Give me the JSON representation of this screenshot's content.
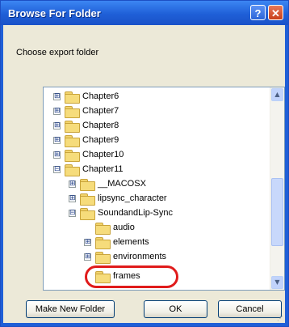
{
  "window": {
    "title": "Browse For Folder",
    "help_label": "?",
    "close_label": "✕"
  },
  "prompt": "Choose export folder",
  "tree": {
    "items": [
      {
        "label": "Chapter6",
        "expander": "⊞"
      },
      {
        "label": "Chapter7",
        "expander": "⊞"
      },
      {
        "label": "Chapter8",
        "expander": "⊞"
      },
      {
        "label": "Chapter9",
        "expander": "⊞"
      },
      {
        "label": "Chapter10",
        "expander": "⊞"
      },
      {
        "label": "Chapter11",
        "expander": "⊟"
      },
      {
        "label": "__MACOSX",
        "expander": "⊞"
      },
      {
        "label": "lipsync_character",
        "expander": "⊞"
      },
      {
        "label": "SoundandLip-Sync",
        "expander": "⊟"
      },
      {
        "label": "audio",
        "expander": ""
      },
      {
        "label": "elements",
        "expander": "⊞"
      },
      {
        "label": "environments",
        "expander": "⊞"
      },
      {
        "label": "frames",
        "expander": ""
      }
    ],
    "scroll_up": "▲",
    "scroll_down": "▼"
  },
  "buttons": {
    "new_folder": "Make New Folder",
    "ok": "OK",
    "cancel": "Cancel"
  },
  "colors": {
    "titlebar": "#1f5fd7",
    "highlight": "#e01b1b",
    "dialog_bg": "#ece9d8"
  }
}
